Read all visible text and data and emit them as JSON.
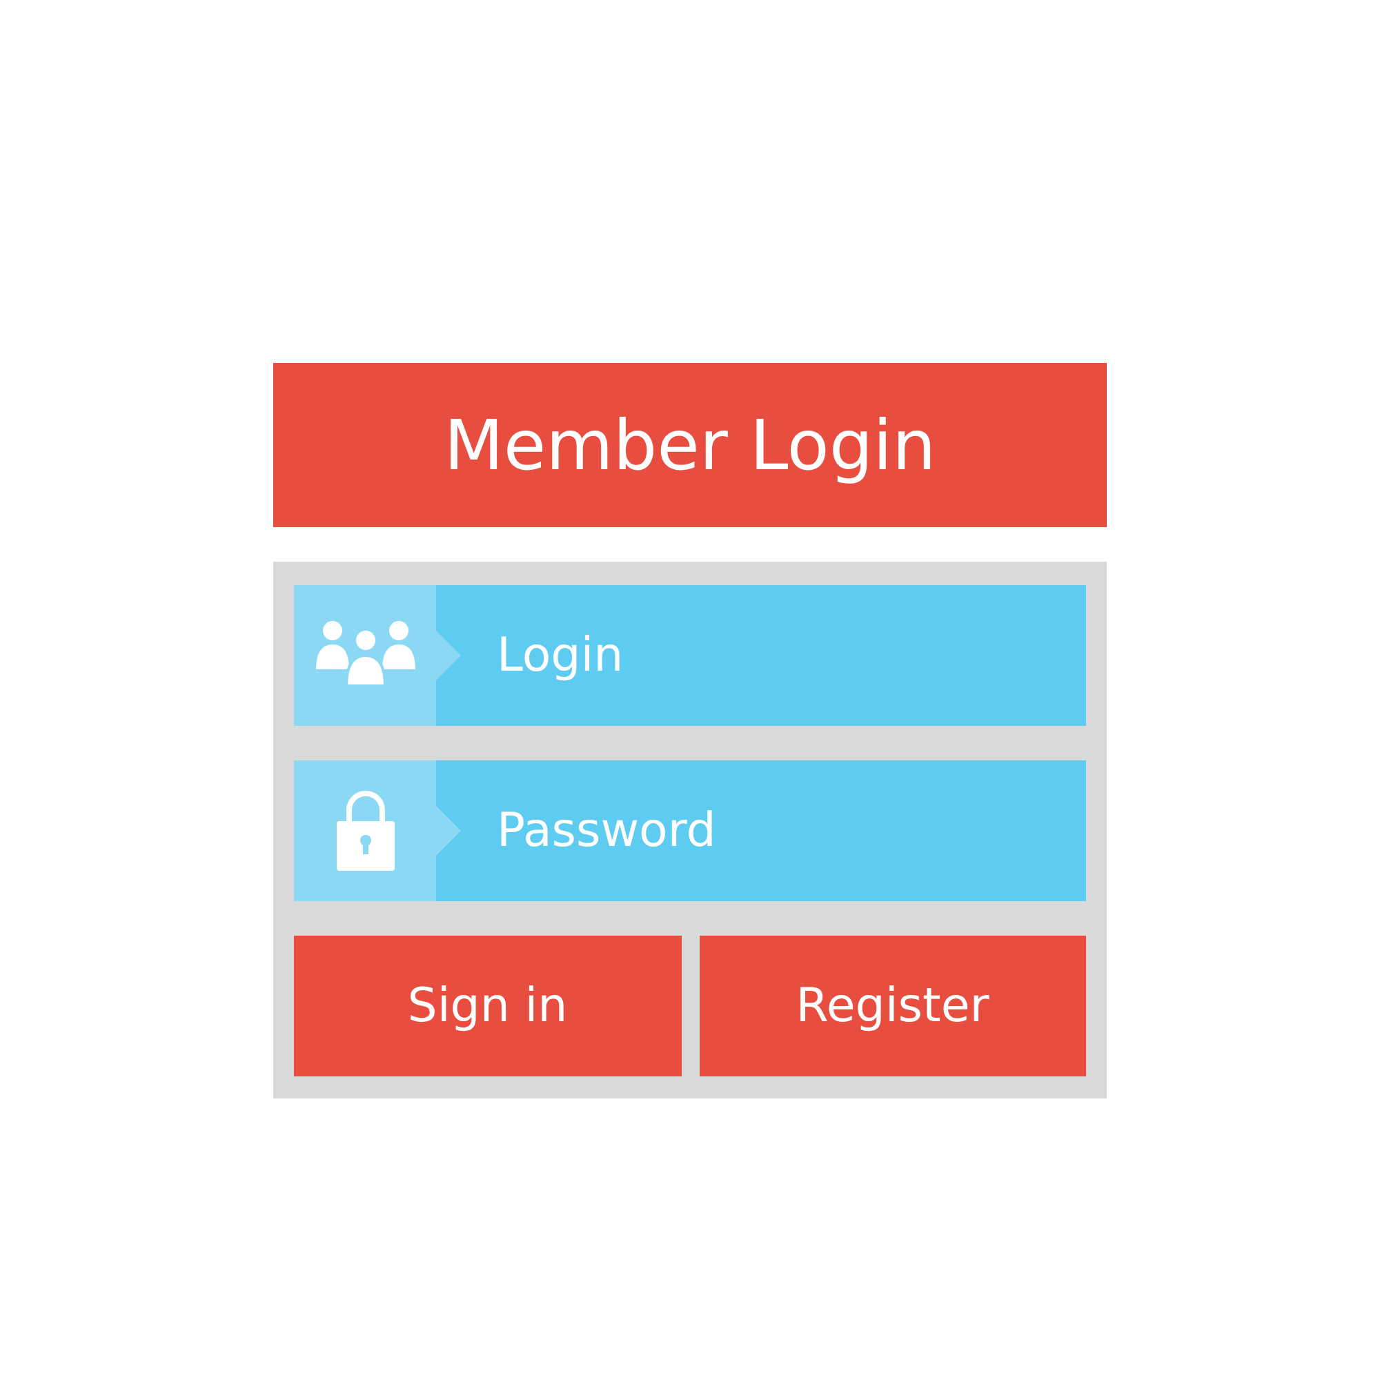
{
  "header": {
    "title": "Member Login"
  },
  "fields": [
    {
      "kind": "user",
      "placeholder": "Login"
    },
    {
      "kind": "password",
      "placeholder": "Password"
    }
  ],
  "buttons": [
    "Sign in",
    "Register"
  ]
}
